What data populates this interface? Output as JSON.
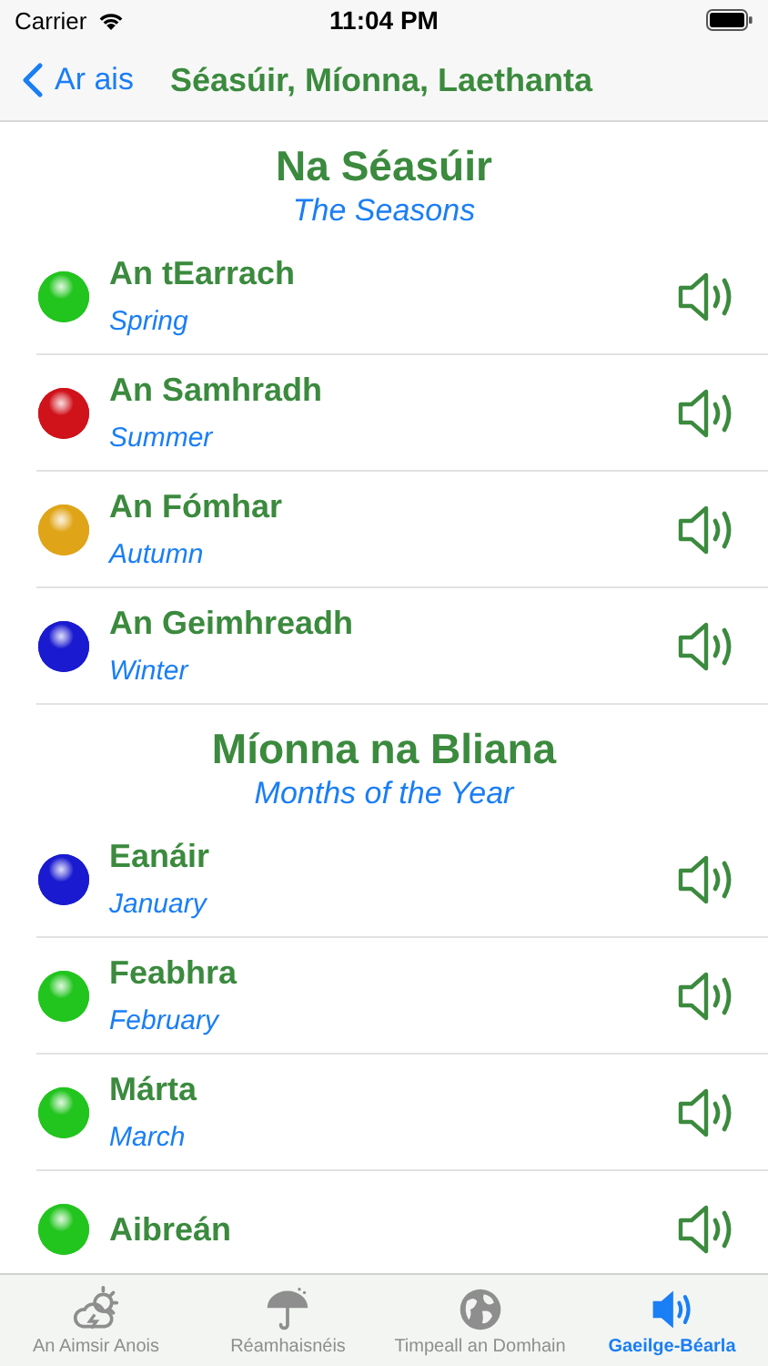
{
  "status_bar": {
    "carrier": "Carrier",
    "time": "11:04 PM"
  },
  "nav": {
    "back": "Ar ais",
    "title": "Séasúir, Míonna, Laethanta"
  },
  "sections": [
    {
      "title": "Na Séasúir",
      "subtitle": "The Seasons",
      "items": [
        {
          "irish": "An tEarrach",
          "english": "Spring",
          "color": "#22c41e"
        },
        {
          "irish": "An Samhradh",
          "english": "Summer",
          "color": "#d0121a"
        },
        {
          "irish": "An Fómhar",
          "english": "Autumn",
          "color": "#e0a418"
        },
        {
          "irish": "An Geimhreadh",
          "english": "Winter",
          "color": "#1a1ad0"
        }
      ]
    },
    {
      "title": "Míonna na Bliana",
      "subtitle": "Months of the Year",
      "items": [
        {
          "irish": "Eanáir",
          "english": "January",
          "color": "#1a1ad0"
        },
        {
          "irish": "Feabhra",
          "english": "February",
          "color": "#22c41e"
        },
        {
          "irish": "Márta",
          "english": "March",
          "color": "#22c41e"
        },
        {
          "irish": "Aibreán",
          "color": "#22c41e"
        }
      ]
    }
  ],
  "tabs": [
    {
      "label": "An Aimsir Anois",
      "kind": "weather",
      "selected": false
    },
    {
      "label": "Réamhaisnéis",
      "kind": "umbrella",
      "selected": false
    },
    {
      "label": "Timpeall an Domhain",
      "kind": "globe",
      "selected": false
    },
    {
      "label": "Gaeilge-Béarla",
      "kind": "speaker",
      "selected": true
    }
  ]
}
